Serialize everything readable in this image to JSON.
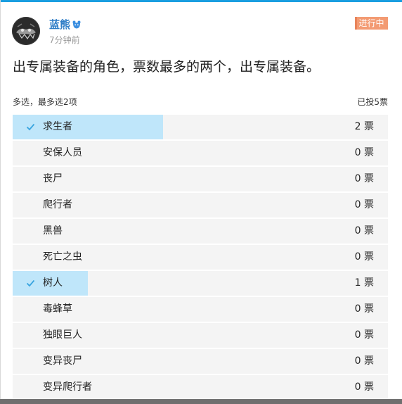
{
  "post": {
    "username": "蓝熊",
    "timestamp": "7分钟前",
    "status": "进行中",
    "question": "出专属装备的角色，票数最多的两个，出专属装备。"
  },
  "poll": {
    "mode_text": "多选，最多选2项",
    "voted_text": "已投5票",
    "options": [
      {
        "label": "求生者",
        "votes_text": "2 票",
        "fraction": 0.4,
        "checked": true
      },
      {
        "label": "安保人员",
        "votes_text": "0 票",
        "fraction": 0,
        "checked": false
      },
      {
        "label": "丧尸",
        "votes_text": "0 票",
        "fraction": 0,
        "checked": false
      },
      {
        "label": "爬行者",
        "votes_text": "0 票",
        "fraction": 0,
        "checked": false
      },
      {
        "label": "黑兽",
        "votes_text": "0 票",
        "fraction": 0,
        "checked": false
      },
      {
        "label": "死亡之虫",
        "votes_text": "0 票",
        "fraction": 0,
        "checked": false
      },
      {
        "label": "树人",
        "votes_text": "1 票",
        "fraction": 0.2,
        "checked": true
      },
      {
        "label": "毒蜂草",
        "votes_text": "0 票",
        "fraction": 0,
        "checked": false
      },
      {
        "label": "独眼巨人",
        "votes_text": "0 票",
        "fraction": 0,
        "checked": false
      },
      {
        "label": "变异丧尸",
        "votes_text": "0 票",
        "fraction": 0,
        "checked": false
      },
      {
        "label": "变异爬行者",
        "votes_text": "0 票",
        "fraction": 0,
        "checked": false
      }
    ]
  },
  "colors": {
    "accent": "#1a9ee0",
    "username": "#2f7ec7",
    "status_badge": "#f39b73",
    "selected_fill": "#bfe6fa",
    "row_background": "#f4f4f4",
    "check": "#3aa5e0"
  },
  "icons": {
    "badge": "bear-badge-icon",
    "check": "check-icon"
  }
}
